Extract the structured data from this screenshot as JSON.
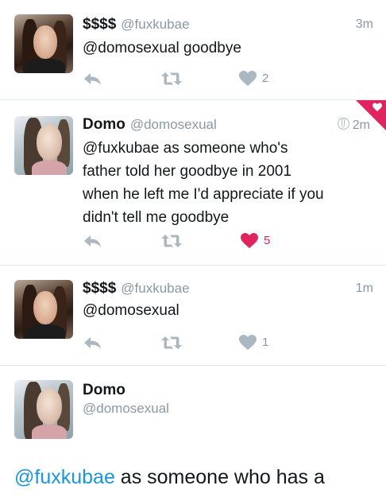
{
  "tweets": [
    {
      "name": "$$$$",
      "handle": "@fuxkubae",
      "time": "3m",
      "text": "@domosexual goodbye",
      "likes": "2",
      "liked": false
    },
    {
      "name": "Domo",
      "handle": "@domosexual",
      "time": "2m",
      "text_lines": [
        "@fuxkubae as someone who's",
        "father told her goodbye in 2001",
        "when he left me I'd appreciate if you",
        "didn't tell me goodbye"
      ],
      "likes": "5",
      "liked": true
    },
    {
      "name": "$$$$",
      "handle": "@fuxkubae",
      "time": "1m",
      "text": "@domosexual",
      "likes": "1",
      "liked": false
    }
  ],
  "detail": {
    "name": "Domo",
    "handle": "@domosexual",
    "mention": "@fuxkubae",
    "text": " as someone who has a"
  },
  "colors": {
    "like_red": "#e0245e",
    "mention_blue": "#1b95e0",
    "muted_gray": "#8899a6"
  },
  "icons": {
    "reply": "reply-icon",
    "retweet": "retweet-icon",
    "like": "heart-icon",
    "globe": "globe-icon"
  }
}
